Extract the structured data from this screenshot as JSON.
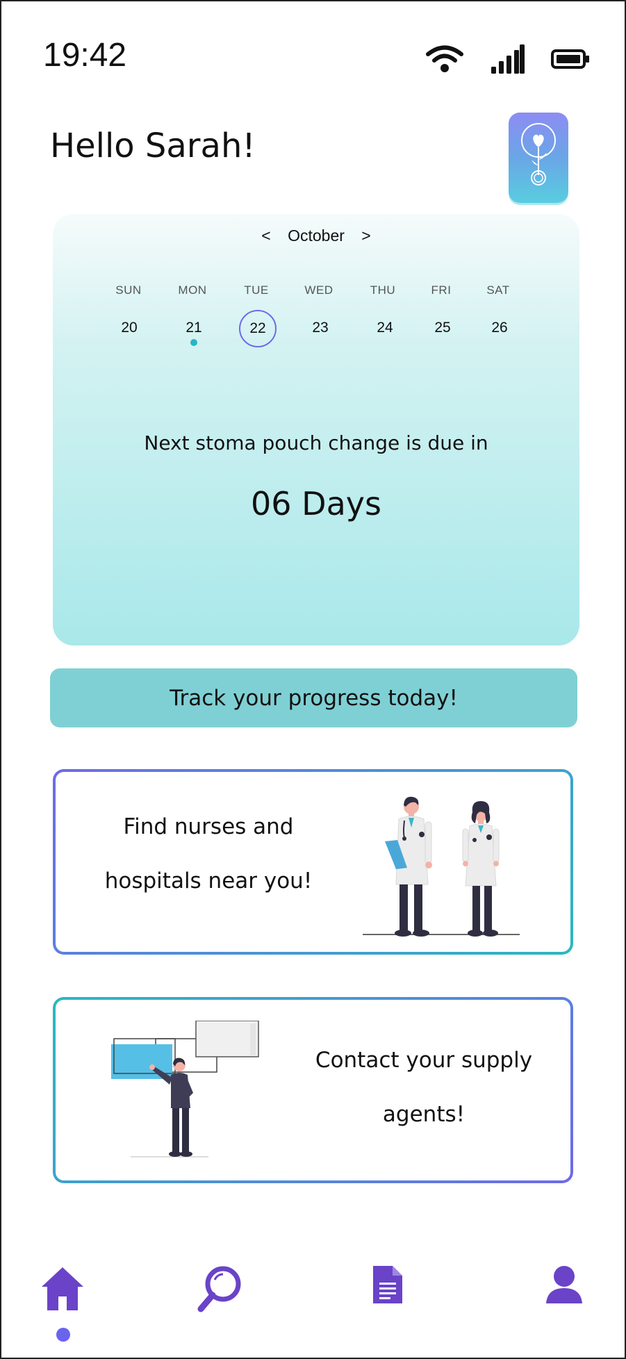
{
  "status_bar": {
    "time": "19:42",
    "icons": [
      "wifi-icon",
      "signal-icon",
      "battery-icon"
    ]
  },
  "header": {
    "greeting": "Hello Sarah!",
    "logo_icon": "heart-sprout-logo"
  },
  "calendar": {
    "prev_label": "<",
    "month": "October",
    "next_label": ">",
    "day_names": [
      "SUN",
      "MON",
      "TUE",
      "WED",
      "THU",
      "FRI",
      "SAT"
    ],
    "dates": [
      "20",
      "21",
      "22",
      "23",
      "24",
      "25",
      "26"
    ],
    "selected_date": "22",
    "marked_date": "21"
  },
  "reminder": {
    "label": "Next stoma pouch change is due in",
    "value": "06 Days"
  },
  "track_button": {
    "label": "Track your progress today!"
  },
  "cards": {
    "nurses": {
      "line1": "Find nurses and",
      "line2": "hospitals near you!"
    },
    "supply": {
      "line1": "Contact your supply",
      "line2": "agents!"
    }
  },
  "bottom_nav": {
    "items": [
      "home-icon",
      "search-icon",
      "document-icon",
      "profile-icon"
    ],
    "active": "home-icon"
  },
  "colors": {
    "accent_purple": "#6a43c8",
    "teal": "#7fd0d4",
    "selected_ring": "#6e6ae8",
    "marker_dot": "#25b7c4"
  }
}
